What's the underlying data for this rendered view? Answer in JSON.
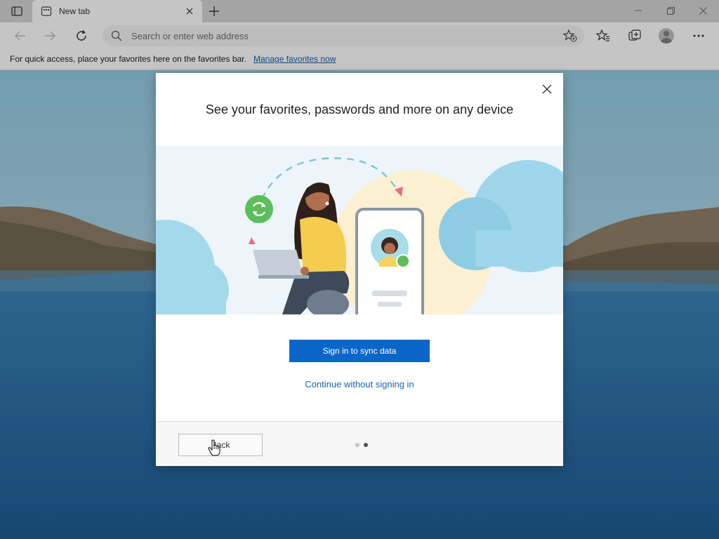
{
  "browser": {
    "tab_title": "New tab",
    "address_placeholder": "Search or enter web address"
  },
  "favorites_bar": {
    "message": "For quick access, place your favorites here on the favorites bar.",
    "manage_link": "Manage favorites now"
  },
  "dialog": {
    "heading": "See your favorites, passwords and more on any device",
    "primary_button": "Sign in to sync data",
    "secondary_link": "Continue without signing in",
    "back_button": "Back",
    "pager": {
      "total": 2,
      "current": 2
    }
  },
  "colors": {
    "primary": "#0a66c8",
    "link": "#1565b0",
    "accent_green": "#5cbd5c"
  }
}
